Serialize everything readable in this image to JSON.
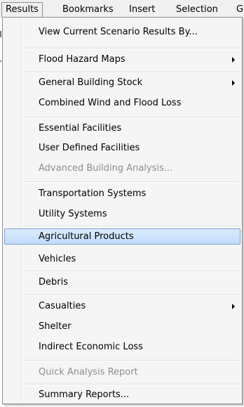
{
  "menubar": {
    "results": "Results",
    "bookmarks": "Bookmarks",
    "insert": "Insert",
    "selection": "Selection",
    "cut_off": "G"
  },
  "menu": {
    "view_current": "View Current Scenario Results By...",
    "flood_hazard_maps": "Flood Hazard Maps",
    "general_building_stock": "General Building Stock",
    "combined_wind_flood": "Combined Wind and Flood Loss",
    "essential_facilities": "Essential Facilities",
    "user_defined_facilities": "User Defined Facilities",
    "advanced_building_analysis": "Advanced Building Analysis...",
    "transportation_systems": "Transportation Systems",
    "utility_systems": "Utility Systems",
    "agricultural_products": "Agricultural Products",
    "vehicles": "Vehicles",
    "debris": "Debris",
    "casualties": "Casualties",
    "shelter": "Shelter",
    "indirect_economic_loss": "Indirect Economic Loss",
    "quick_analysis_report": "Quick Analysis Report",
    "summary_reports": "Summary Reports..."
  },
  "colors": {
    "highlight_border": "#7da2ce",
    "disabled_text": "#8d8d8d",
    "menu_background": "#f5f5f5"
  },
  "icons": {
    "submenu": "chevron-right-icon"
  }
}
